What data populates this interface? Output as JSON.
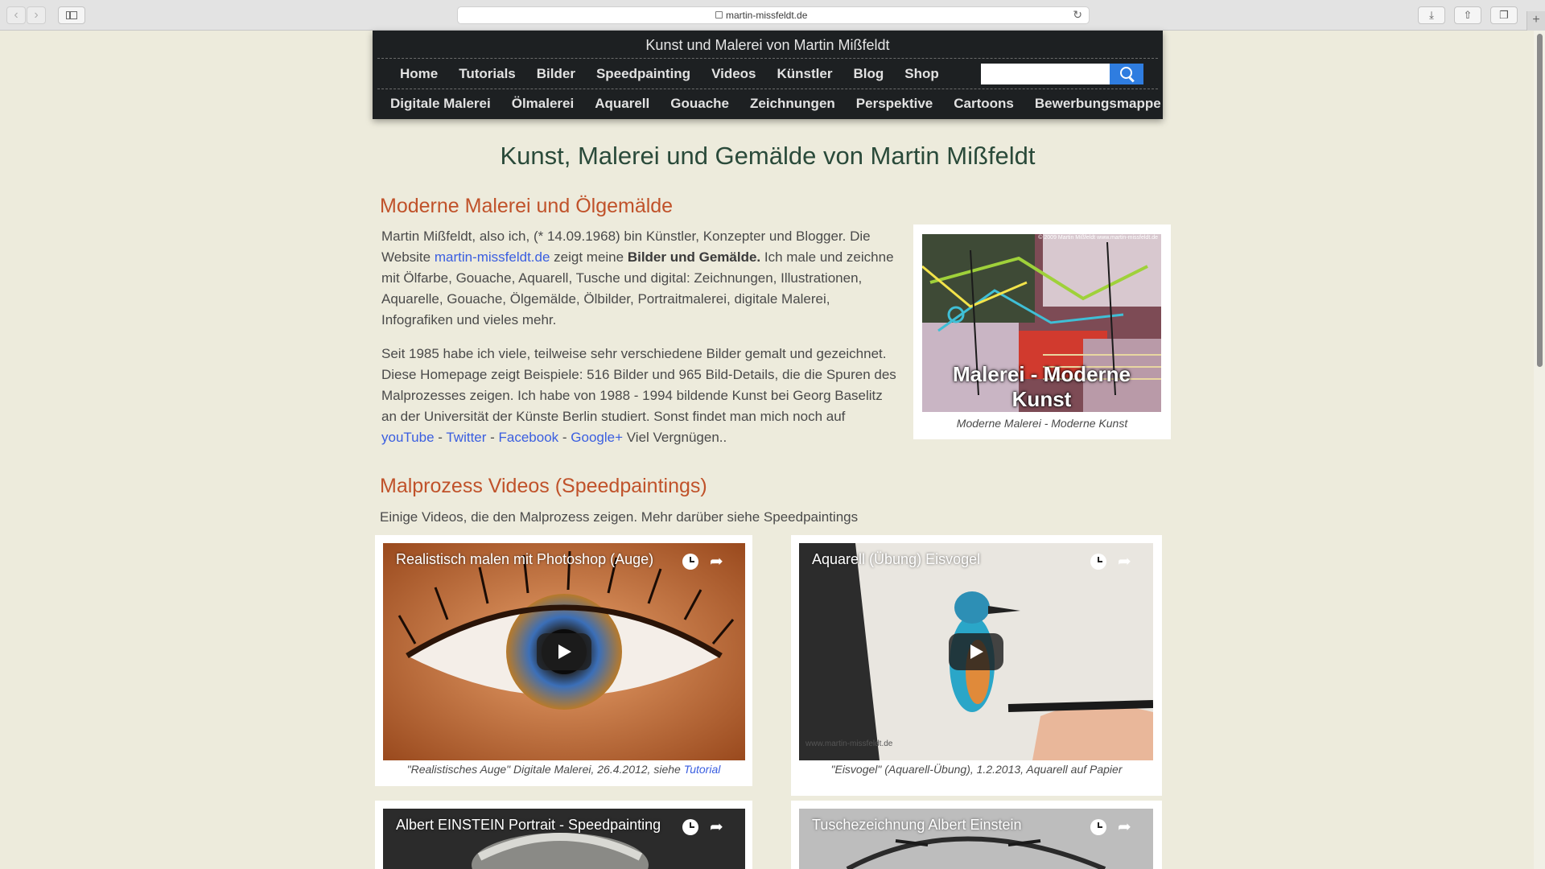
{
  "browser": {
    "url": "martin-missfeldt.de",
    "back": "‹",
    "forward": "›",
    "reload": "↻",
    "download": "⤓",
    "share": "⇧",
    "tabs": "❐",
    "new_tab": "+"
  },
  "header": {
    "site_title": "Kunst und Malerei von Martin Mißfeldt",
    "nav_primary": [
      "Home",
      "Tutorials",
      "Bilder",
      "Speedpainting",
      "Videos",
      "Künstler",
      "Blog",
      "Shop"
    ],
    "nav_secondary": [
      "Digitale Malerei",
      "Ölmalerei",
      "Aquarell",
      "Gouache",
      "Zeichnungen",
      "Perspektive",
      "Cartoons",
      "Bewerbungsmappe"
    ],
    "search_placeholder": ""
  },
  "main": {
    "page_title": "Kunst, Malerei und Gemälde von Martin Mißfeldt",
    "section1": {
      "heading": "Moderne Malerei und Ölgemälde",
      "p1_a": "Martin Mißfeldt, also ich, (* 14.09.1968) bin Künstler, Konzepter und Blogger. Die Website ",
      "p1_link": "martin-missfeldt.de",
      "p1_b": " zeigt meine ",
      "p1_bold": "Bilder und Gemälde.",
      "p1_c": " Ich male und zeichne mit Ölfarbe, Gouache, Aquarell, Tusche und digital: Zeichnungen, Illustrationen, Aquarelle, Gouache, Ölgemälde, Ölbilder, Portraitmalerei, digitale Malerei, Infografiken und vieles mehr.",
      "p2_a": "Seit 1985 habe ich viele, teilweise sehr verschiedene Bilder gemalt und gezeichnet. Diese Homepage zeigt Beispiele: 516 Bilder und 965 Bild-Details, die die Spuren des Malprozesses zeigen. Ich habe von 1988 - 1994 bildende Kunst bei Georg Baselitz an der Universität der Künste Berlin studiert. Sonst findet man mich noch auf ",
      "link_youtube": "youTube",
      "sep1": " - ",
      "link_twitter": "Twitter",
      "sep2": " - ",
      "link_facebook": "Facebook",
      "sep3": " - ",
      "link_google": "Google+",
      "p2_end": " Viel Vergnügen..",
      "figure_overlay": "Malerei - Moderne Kunst",
      "figure_copyright": "© 2009 Martin Mißfeldt   www.martin-missfeldt.de",
      "figure_caption": "Moderne Malerei - Moderne Kunst"
    },
    "section2": {
      "heading": "Malprozess Videos (Speedpaintings)",
      "intro": "Einige Videos, die den Malprozess zeigen. Mehr darüber siehe Speedpaintings",
      "videos": [
        {
          "title": "Realistisch malen mit Photoshop (Auge)",
          "caption": "\"Realistisches Auge\" Digitale Malerei, 26.4.2012, siehe ",
          "caption_link": "Tutorial"
        },
        {
          "title": "Aquarell (Übung) Eisvogel",
          "caption": "\"Eisvogel\" (Aquarell-Übung), 1.2.2013, Aquarell auf Papier",
          "watermark": "www.martin-missfeldt.de"
        },
        {
          "title": "Albert EINSTEIN Portrait - Speedpainting"
        },
        {
          "title": "Tuschezeichnung Albert Einstein"
        }
      ]
    }
  }
}
